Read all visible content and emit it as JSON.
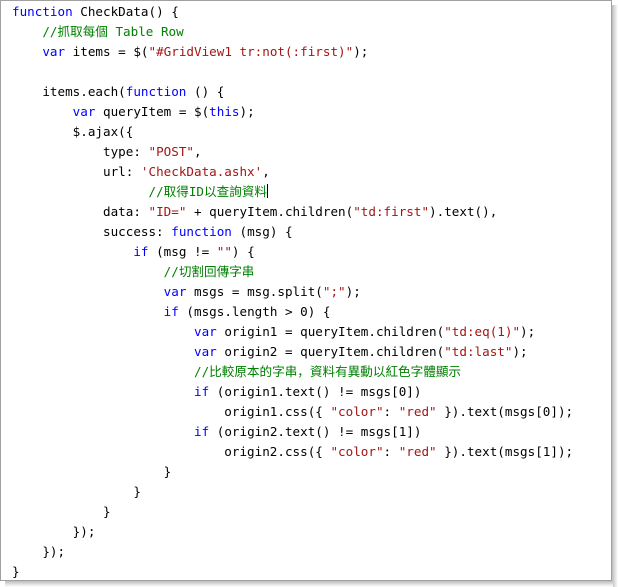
{
  "colors": {
    "plain": "#000000",
    "keyword": "#0000ff",
    "string": "#a31515",
    "comment": "#008000"
  },
  "code": {
    "lines": [
      [
        [
          "keyword",
          "function"
        ],
        [
          "plain",
          " CheckData() {"
        ]
      ],
      [
        [
          "plain",
          "    "
        ],
        [
          "comment",
          "//抓取每個 Table Row"
        ]
      ],
      [
        [
          "plain",
          "    "
        ],
        [
          "keyword",
          "var"
        ],
        [
          "plain",
          " items = $("
        ],
        [
          "string",
          "\"#GridView1 tr:not(:first)\""
        ],
        [
          "plain",
          ");"
        ]
      ],
      [],
      [
        [
          "plain",
          "    items.each("
        ],
        [
          "keyword",
          "function"
        ],
        [
          "plain",
          " () {"
        ]
      ],
      [
        [
          "plain",
          "        "
        ],
        [
          "keyword",
          "var"
        ],
        [
          "plain",
          " queryItem = $("
        ],
        [
          "keyword",
          "this"
        ],
        [
          "plain",
          ");"
        ]
      ],
      [
        [
          "plain",
          "        $.ajax({"
        ]
      ],
      [
        [
          "plain",
          "            type: "
        ],
        [
          "string",
          "\"POST\""
        ],
        [
          "plain",
          ","
        ]
      ],
      [
        [
          "plain",
          "            url: "
        ],
        [
          "string",
          "'CheckData.ashx'"
        ],
        [
          "plain",
          ","
        ]
      ],
      [
        [
          "plain",
          "                  "
        ],
        [
          "comment",
          "//取得ID以查詢資料"
        ],
        [
          "caret",
          ""
        ]
      ],
      [
        [
          "plain",
          "            data: "
        ],
        [
          "string",
          "\"ID=\""
        ],
        [
          "plain",
          " + queryItem.children("
        ],
        [
          "string",
          "\"td:first\""
        ],
        [
          "plain",
          ").text(),"
        ]
      ],
      [
        [
          "plain",
          "            success: "
        ],
        [
          "keyword",
          "function"
        ],
        [
          "plain",
          " (msg) {"
        ]
      ],
      [
        [
          "plain",
          "                "
        ],
        [
          "keyword",
          "if"
        ],
        [
          "plain",
          " (msg != "
        ],
        [
          "string",
          "\"\""
        ],
        [
          "plain",
          ") {"
        ]
      ],
      [
        [
          "plain",
          "                    "
        ],
        [
          "comment",
          "//切割回傳字串"
        ]
      ],
      [
        [
          "plain",
          "                    "
        ],
        [
          "keyword",
          "var"
        ],
        [
          "plain",
          " msgs = msg.split("
        ],
        [
          "string",
          "\";\""
        ],
        [
          "plain",
          ");"
        ]
      ],
      [
        [
          "plain",
          "                    "
        ],
        [
          "keyword",
          "if"
        ],
        [
          "plain",
          " (msgs.length > 0) {"
        ]
      ],
      [
        [
          "plain",
          "                        "
        ],
        [
          "keyword",
          "var"
        ],
        [
          "plain",
          " origin1 = queryItem.children("
        ],
        [
          "string",
          "\"td:eq(1)\""
        ],
        [
          "plain",
          ");"
        ]
      ],
      [
        [
          "plain",
          "                        "
        ],
        [
          "keyword",
          "var"
        ],
        [
          "plain",
          " origin2 = queryItem.children("
        ],
        [
          "string",
          "\"td:last\""
        ],
        [
          "plain",
          ");"
        ]
      ],
      [
        [
          "plain",
          "                        "
        ],
        [
          "comment",
          "//比較原本的字串，資料有異動以紅色字體顯示"
        ]
      ],
      [
        [
          "plain",
          "                        "
        ],
        [
          "keyword",
          "if"
        ],
        [
          "plain",
          " (origin1.text() != msgs[0])"
        ]
      ],
      [
        [
          "plain",
          "                            origin1.css({ "
        ],
        [
          "string",
          "\"color\""
        ],
        [
          "plain",
          ": "
        ],
        [
          "string",
          "\"red\""
        ],
        [
          "plain",
          " }).text(msgs[0]);"
        ]
      ],
      [
        [
          "plain",
          "                        "
        ],
        [
          "keyword",
          "if"
        ],
        [
          "plain",
          " (origin2.text() != msgs[1])"
        ]
      ],
      [
        [
          "plain",
          "                            origin2.css({ "
        ],
        [
          "string",
          "\"color\""
        ],
        [
          "plain",
          ": "
        ],
        [
          "string",
          "\"red\""
        ],
        [
          "plain",
          " }).text(msgs[1]);"
        ]
      ],
      [
        [
          "plain",
          "                    }"
        ]
      ],
      [
        [
          "plain",
          "                }"
        ]
      ],
      [
        [
          "plain",
          "            }"
        ]
      ],
      [
        [
          "plain",
          "        });"
        ]
      ],
      [
        [
          "plain",
          "    });"
        ]
      ],
      [
        [
          "plain",
          "}"
        ]
      ]
    ]
  }
}
